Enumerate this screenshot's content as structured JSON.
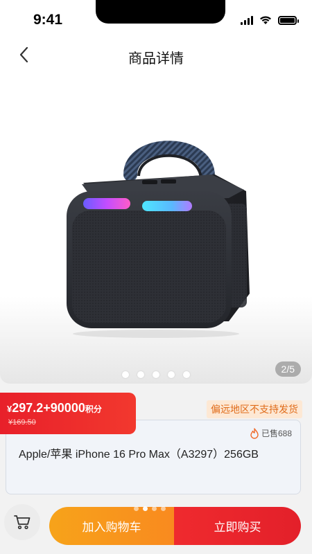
{
  "status_bar": {
    "time": "9:41"
  },
  "nav": {
    "title": "商品详情",
    "back_icon": "chevron-left-icon"
  },
  "gallery": {
    "counter": "2/5",
    "dot_count": 5
  },
  "price": {
    "main": "297.2+90000",
    "currency": "¥",
    "points_unit": "积分",
    "original": "¥169.50"
  },
  "shipping_note": "偏远地区不支持发货",
  "product": {
    "sold": "已售688",
    "title": "Apple/苹果 iPhone 16 Pro Max（A3297）256GB"
  },
  "actions": {
    "cart_icon": "cart-icon",
    "add_to_cart": "加入购物车",
    "buy_now": "立即购买"
  },
  "colors": {
    "price_red": "#e8202a",
    "shipping_orange": "#e06c1a",
    "add_cart_orange": "#f8981c",
    "buy_red": "#e8252c"
  }
}
